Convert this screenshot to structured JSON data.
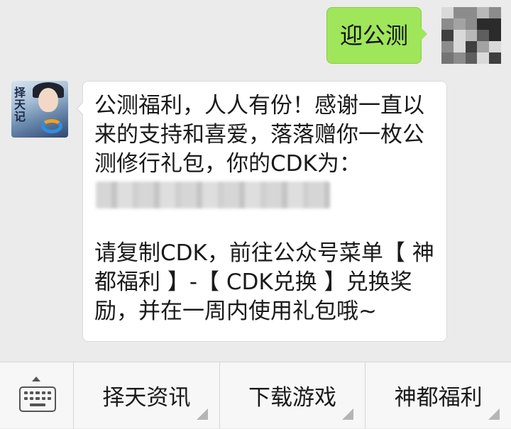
{
  "chat": {
    "outgoing": {
      "text": "迎公测"
    },
    "incoming": {
      "lines": [
        "公测福利，人人有份！感谢一直以",
        "来的支持和喜爱，落落赠你一枚公",
        "测修行礼包，你的CDK为："
      ],
      "instructions": [
        "请复制CDK，前往公众号菜单【 神",
        "都福利 】-【 CDK兑换 】兑换奖",
        "励，并在一周内使用礼包哦~"
      ],
      "avatar_logo_text": "择天记"
    }
  },
  "menu": {
    "keyboard_icon": "keyboard-icon",
    "items": [
      {
        "label": "择天资讯"
      },
      {
        "label": "下载游戏"
      },
      {
        "label": "神都福利"
      }
    ]
  },
  "colors": {
    "background": "#ebebeb",
    "outgoing_bubble": "#9fe65a",
    "incoming_bubble": "#ffffff",
    "menu_bar": "#f7f7f7"
  }
}
